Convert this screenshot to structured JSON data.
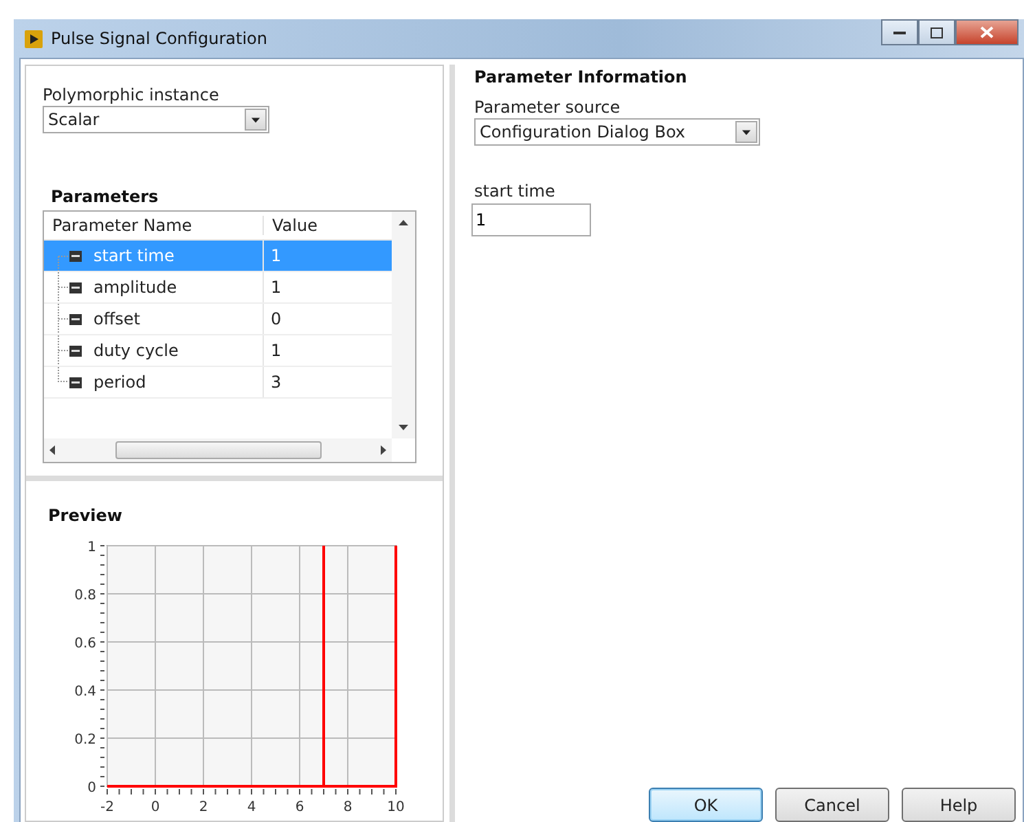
{
  "window": {
    "title": "Pulse Signal Configuration"
  },
  "polymorphic_instance": {
    "label": "Polymorphic instance",
    "value": "Scalar"
  },
  "parameters": {
    "title": "Parameters",
    "columns": [
      "Parameter Name",
      "Value"
    ],
    "rows": [
      {
        "name": "start time",
        "value": "1",
        "selected": true
      },
      {
        "name": "amplitude",
        "value": "1",
        "selected": false
      },
      {
        "name": "offset",
        "value": "0",
        "selected": false
      },
      {
        "name": "duty cycle",
        "value": "1",
        "selected": false
      },
      {
        "name": "period",
        "value": "3",
        "selected": false
      }
    ]
  },
  "preview": {
    "title": "Preview",
    "chart_data": {
      "type": "line",
      "x": [
        -2,
        7,
        7,
        7,
        10,
        10
      ],
      "series": [
        {
          "color": "#ff0000",
          "values": [
            0,
            0,
            1,
            0,
            0,
            1
          ]
        }
      ],
      "grid": true,
      "xlim": [
        -2,
        10
      ],
      "ylim": [
        0,
        1
      ],
      "xticks": [
        -2,
        0,
        2,
        4,
        6,
        8,
        10
      ],
      "yticks": [
        0,
        0.2,
        0.4,
        0.6,
        0.8,
        1
      ]
    }
  },
  "parameter_information": {
    "title": "Parameter Information",
    "source_label": "Parameter source",
    "source_value": "Configuration Dialog Box",
    "field_label": "start time",
    "field_value": "1"
  },
  "buttons": [
    {
      "label": "OK",
      "default": true
    },
    {
      "label": "Cancel",
      "default": false
    },
    {
      "label": "Help",
      "default": false
    }
  ]
}
